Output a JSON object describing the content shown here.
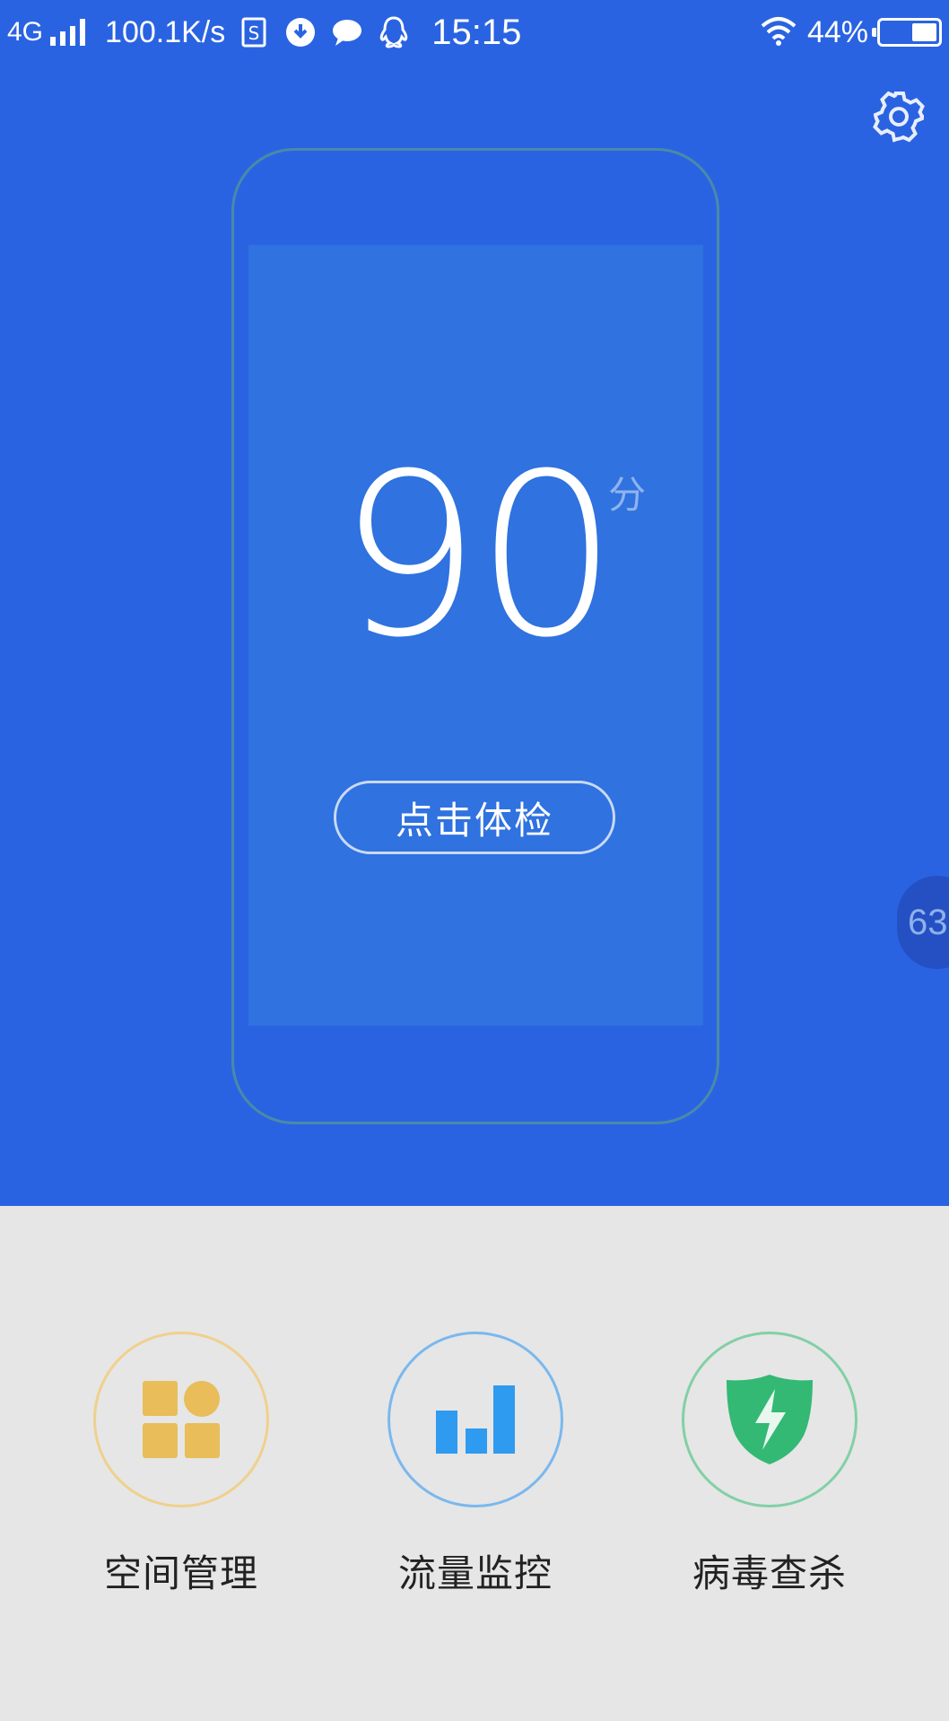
{
  "status_bar": {
    "network": "4G",
    "speed": "100.1K/s",
    "time": "15:15",
    "battery": "44%",
    "battery_level": 0.44,
    "icons": [
      "signal-icon",
      "sim-icon",
      "download-icon",
      "message-icon",
      "qq-icon",
      "wifi-icon",
      "battery-icon"
    ]
  },
  "header": {
    "settings_icon": "gear-icon"
  },
  "score": {
    "value": "90",
    "unit": "分"
  },
  "check_button": {
    "label": "点击体检"
  },
  "side_tab": {
    "label": "63"
  },
  "features": [
    {
      "label": "空间管理",
      "icon": "space-manage-icon",
      "color": "#e8bd5a"
    },
    {
      "label": "流量监控",
      "icon": "traffic-monitor-icon",
      "color": "#2f9bf0"
    },
    {
      "label": "病毒查杀",
      "icon": "virus-scan-shield-icon",
      "color": "#33b974"
    }
  ],
  "colors": {
    "primary_blue": "#2a63e2",
    "screen_blue": "#2f72e0",
    "background_gray": "#e6e6e6"
  }
}
